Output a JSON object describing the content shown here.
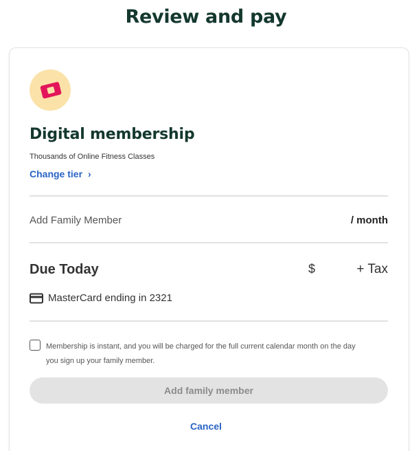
{
  "page": {
    "title": "Review and pay"
  },
  "membership": {
    "icon": "ticket-icon",
    "icon_colors": {
      "background": "#fbe2a9",
      "ticket": "#e3155a"
    },
    "title": "Digital membership",
    "subtitle": "Thousands of Online Fitness Classes",
    "change_tier_label": "Change tier",
    "change_tier_chevron": "›"
  },
  "family": {
    "label": "Add Family Member",
    "price_suffix": "/ month"
  },
  "due": {
    "label": "Due Today",
    "currency": "$",
    "tax": "+ Tax"
  },
  "payment": {
    "icon": "credit-card-icon",
    "text": "MasterCard ending in 2321"
  },
  "consent": {
    "checked": false,
    "text": "Membership is instant, and you will be charged for the full current calendar month on the day you sign up your family member."
  },
  "actions": {
    "primary_label": "Add family member",
    "primary_disabled": true,
    "cancel_label": "Cancel"
  },
  "colors": {
    "title": "#14382e",
    "link": "#2a64c5",
    "disabled_bg": "#e3e3e3"
  }
}
